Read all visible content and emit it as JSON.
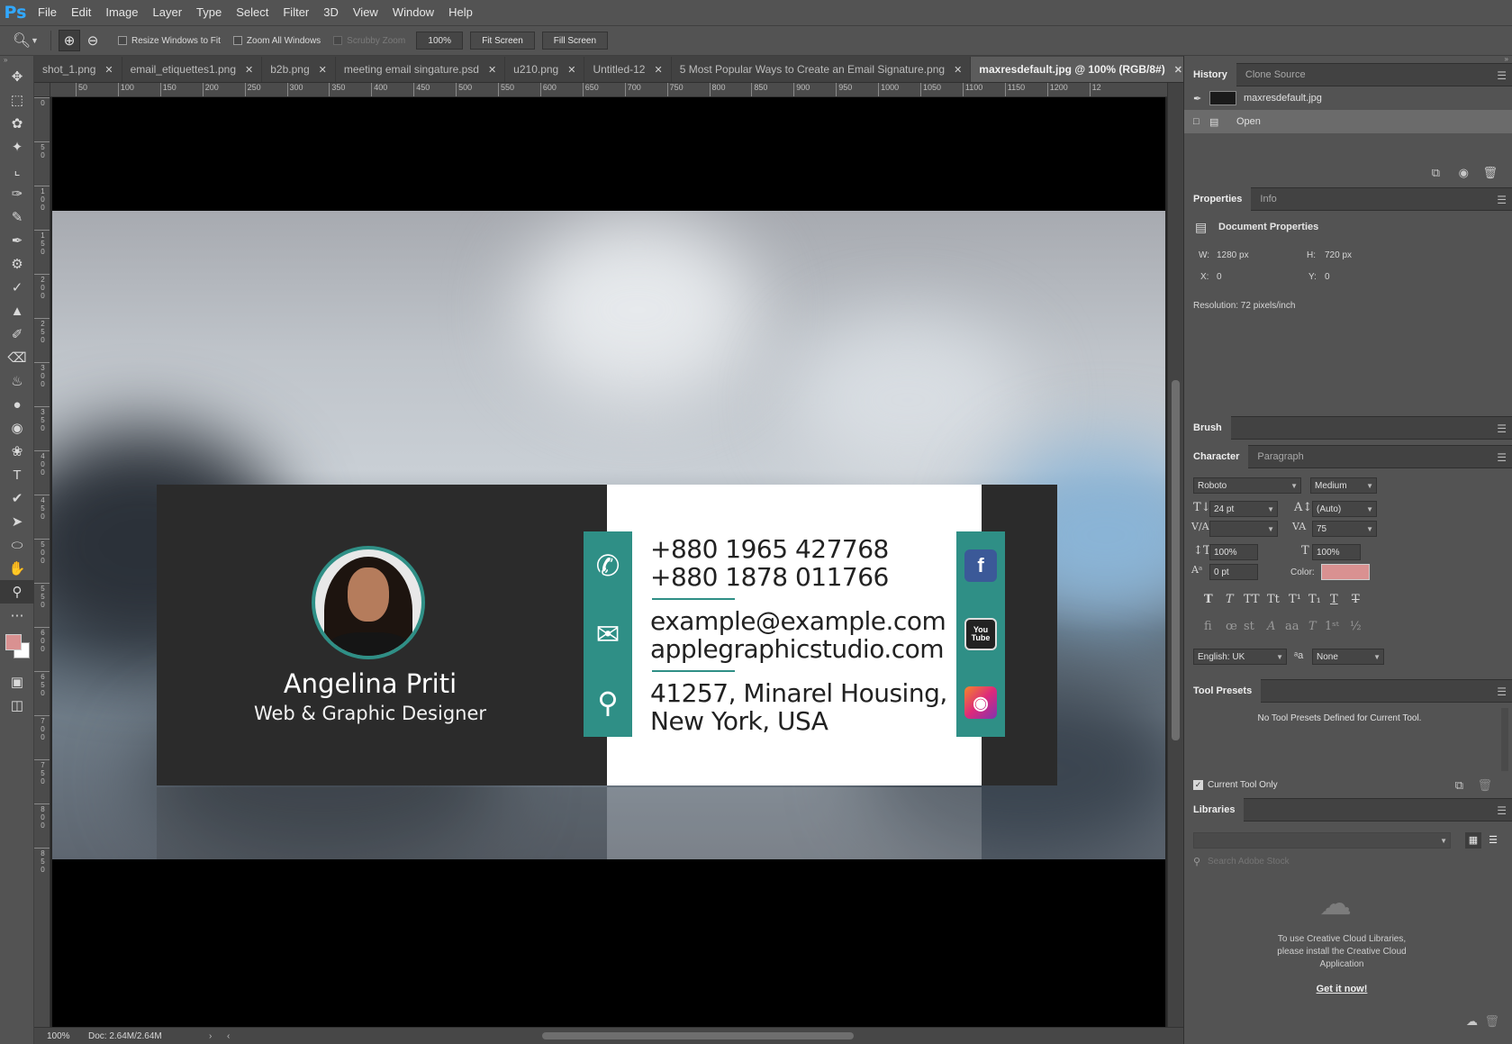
{
  "app": {
    "logo": "Ps"
  },
  "menu": [
    "File",
    "Edit",
    "Image",
    "Layer",
    "Type",
    "Select",
    "Filter",
    "3D",
    "View",
    "Window",
    "Help"
  ],
  "options": {
    "tool_icon": "zoom-icon",
    "resize_windows": "Resize Windows to Fit",
    "zoom_all_windows": "Zoom All Windows",
    "scrubby_zoom": "Scrubby Zoom",
    "zoom_value": "100%",
    "fit_screen": "Fit Screen",
    "fill_screen": "Fill Screen"
  },
  "tabs": [
    {
      "label": "shot_1.png"
    },
    {
      "label": "email_etiquettes1.png"
    },
    {
      "label": "b2b.png"
    },
    {
      "label": "meeting email singature.psd"
    },
    {
      "label": "u210.png"
    },
    {
      "label": "Untitled-12"
    },
    {
      "label": "5 Most Popular Ways to Create an Email Signature.png"
    },
    {
      "label": "maxresdefault.jpg @ 100% (RGB/8#)"
    }
  ],
  "rulers": {
    "h": [
      "50",
      "100",
      "150",
      "200",
      "250",
      "300",
      "350",
      "400",
      "450",
      "500",
      "550",
      "600",
      "650",
      "700",
      "750",
      "800",
      "850",
      "900",
      "950",
      "1000",
      "1050",
      "1100",
      "1150",
      "1200",
      "12"
    ],
    "v": [
      "0",
      "50",
      "100",
      "150",
      "200",
      "250",
      "300",
      "350",
      "400",
      "450",
      "500",
      "550",
      "600",
      "650",
      "700",
      "750",
      "800",
      "850"
    ]
  },
  "canvas": {
    "name": "Angelina Priti",
    "title": "Web & Graphic Designer",
    "phone1": "+880 1965 427768",
    "phone2": "+880 1878 011766",
    "email1": "example@example.com",
    "email2": "applegraphicstudio.com",
    "address1": "41257, Minarel Housing,",
    "address2": "New York, USA",
    "youtube_label": "You Tube",
    "facebook_label": "f",
    "accent": "#2f8f86"
  },
  "status": {
    "zoom": "100%",
    "doc": "Doc: 2.64M/2.64M"
  },
  "history": {
    "tabs": [
      "History",
      "Clone Source"
    ],
    "snapshot": "maxresdefault.jpg",
    "step": "Open"
  },
  "properties": {
    "tabs": [
      "Properties",
      "Info"
    ],
    "heading": "Document Properties",
    "w_label": "W:",
    "w": "1280 px",
    "h_label": "H:",
    "h": "720 px",
    "x_label": "X:",
    "x": "0",
    "y_label": "Y:",
    "y": "0",
    "resolution": "Resolution: 72 pixels/inch"
  },
  "brush": {
    "tab": "Brush"
  },
  "character": {
    "tabs": [
      "Character",
      "Paragraph"
    ],
    "font": "Roboto",
    "style": "Medium",
    "size": "24 pt",
    "leading": "(Auto)",
    "kerning": "",
    "tracking": "75",
    "vscale": "100%",
    "hscale": "100%",
    "baseline": "0 pt",
    "color_label": "Color:",
    "color": "#d99191",
    "language": "English: UK",
    "aa_label": "aa",
    "antialias": "None"
  },
  "tool_presets": {
    "tab": "Tool Presets",
    "empty": "No Tool Presets Defined for Current Tool.",
    "current_only": "Current Tool Only"
  },
  "libraries": {
    "tab": "Libraries",
    "search_placeholder": "Search Adobe Stock",
    "message": "To use Creative Cloud Libraries, please install the Creative Cloud Application",
    "link": "Get it now!"
  }
}
